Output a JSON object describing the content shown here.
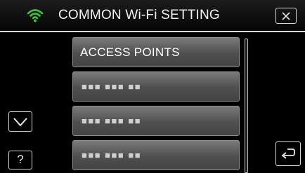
{
  "header": {
    "title": "COMMON Wi-Fi SETTING",
    "wifi_icon": "wifi-icon",
    "close_icon": "close-icon",
    "wifi_color": "#3cc43c"
  },
  "list": {
    "items": [
      {
        "label": "ACCESS POINTS",
        "masked": false
      },
      {
        "label": "■■■ ■■■ ■■",
        "masked": true
      },
      {
        "label": "■■■ ■■■ ■■",
        "masked": true
      },
      {
        "label": "■■■ ■■■ ■■",
        "masked": true
      }
    ]
  },
  "nav": {
    "down_icon": "chevron-down-icon",
    "help_label": "?",
    "back_icon": "return-arrow-icon"
  }
}
